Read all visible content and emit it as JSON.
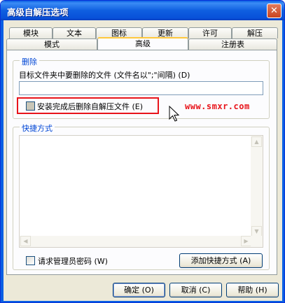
{
  "window": {
    "title": "高级自解压选项",
    "close_label": "✕"
  },
  "tabs_row1": [
    {
      "label": "模块"
    },
    {
      "label": "文本"
    },
    {
      "label": "图标"
    },
    {
      "label": "更新"
    },
    {
      "label": "许可"
    },
    {
      "label": "解压"
    }
  ],
  "tabs_row2": [
    {
      "label": "模式"
    },
    {
      "label": "高级",
      "active": true
    },
    {
      "label": "注册表"
    }
  ],
  "delete_group": {
    "legend": "删除",
    "field_label": "目标文件夹中要删除的文件 (文件名以\";\"间隔) (D)",
    "field_value": "",
    "checkbox_label": "安装完成后删除自解压文件 (E)",
    "checkbox_checked": false
  },
  "watermark": "www.smxr.com",
  "shortcut_group": {
    "legend": "快捷方式",
    "request_admin_label": "请求管理员密码 (W)",
    "request_admin_checked": false,
    "add_shortcut_label": "添加快捷方式 (A)"
  },
  "footer": {
    "ok_label": "确定 (O)",
    "cancel_label": "取消 (C)",
    "help_label": "帮助 (H)"
  },
  "icons": {
    "close": "close-icon",
    "cursor": "mouse-pointer-icon",
    "scroll_up": "scroll-up-arrow-icon",
    "scroll_down": "scroll-down-arrow-icon",
    "scroll_left": "scroll-left-arrow-icon",
    "scroll_right": "scroll-right-arrow-icon"
  },
  "colors": {
    "title_bar": "#0a5fe3",
    "group_legend": "#0046d5",
    "highlight": "#e8141b",
    "active_tab_accent": "#ffc83c"
  }
}
